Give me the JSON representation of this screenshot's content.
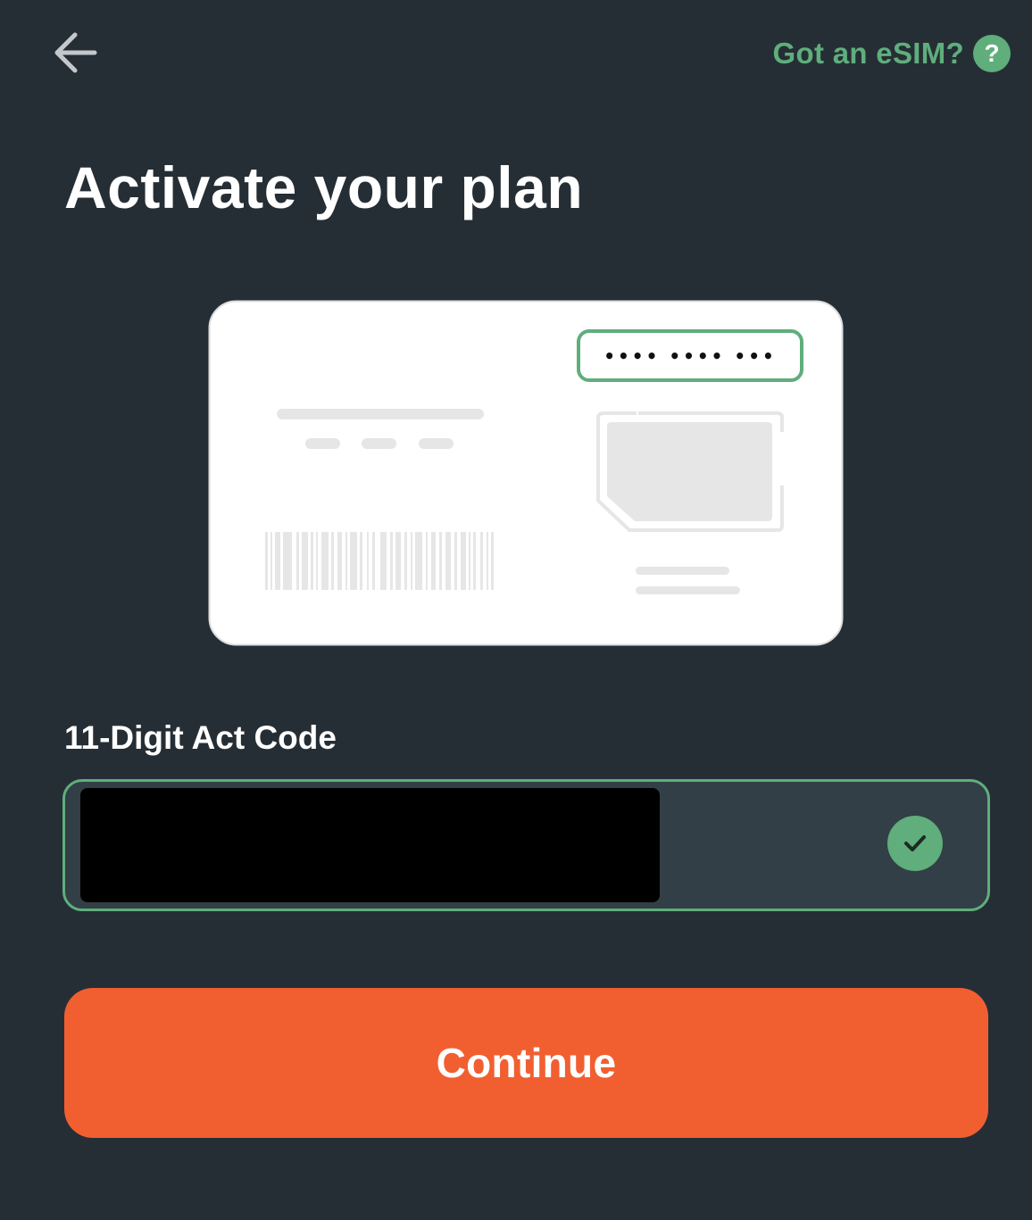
{
  "header": {
    "back_icon": "arrow-left-icon",
    "esim_link_label": "Got an eSIM?",
    "help_icon": "question-mark-icon",
    "help_icon_glyph": "?"
  },
  "main": {
    "title": "Activate your plan",
    "illustration": {
      "name": "sim-card-illustration",
      "masked_code": "•••• •••• •••"
    },
    "act_code": {
      "label": "11-Digit Act Code",
      "value": "",
      "value_redacted": true,
      "status_icon": "checkmark-icon",
      "valid": true
    },
    "continue_label": "Continue"
  },
  "colors": {
    "background": "#262e35",
    "accent_green": "#5fae7c",
    "primary_button": "#f15f31",
    "input_background": "#323f46",
    "text": "#ffffff"
  }
}
